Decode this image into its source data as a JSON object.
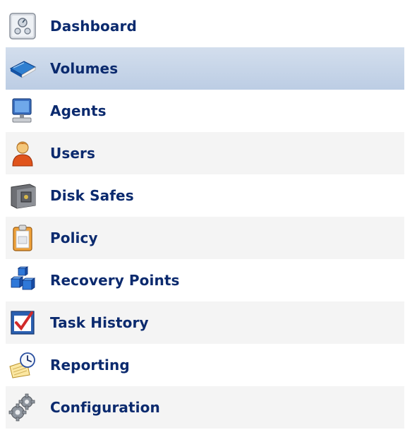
{
  "nav": {
    "selected": "Volumes",
    "items": [
      {
        "label": "Dashboard",
        "icon": "dashboard-icon"
      },
      {
        "label": "Volumes",
        "icon": "volumes-book-icon"
      },
      {
        "label": "Agents",
        "icon": "agents-computer-icon"
      },
      {
        "label": "Users",
        "icon": "users-person-icon"
      },
      {
        "label": "Disk Safes",
        "icon": "disk-safe-icon"
      },
      {
        "label": "Policy",
        "icon": "policy-clipboard-icon"
      },
      {
        "label": "Recovery Points",
        "icon": "recovery-points-cubes-icon"
      },
      {
        "label": "Task History",
        "icon": "task-history-checkbox-icon"
      },
      {
        "label": "Reporting",
        "icon": "reporting-clock-icon"
      },
      {
        "label": "Configuration",
        "icon": "configuration-gears-icon"
      }
    ]
  },
  "colors": {
    "label_text": "#0b2a6e",
    "selected_bg": "#c8d6ea",
    "alt_row_bg": "#f4f4f4"
  }
}
